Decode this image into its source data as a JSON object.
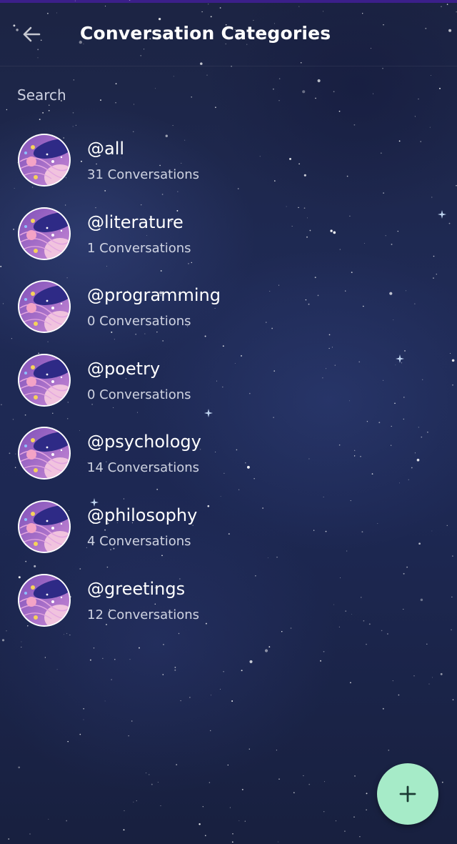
{
  "header": {
    "title": "Conversation Categories",
    "back_icon": "arrow-left-icon"
  },
  "search": {
    "placeholder": "Search",
    "value": ""
  },
  "categories": [
    {
      "name": "@all",
      "count": "31 Conversations"
    },
    {
      "name": "@literature",
      "count": "1 Conversations"
    },
    {
      "name": "@programming",
      "count": "0 Conversations"
    },
    {
      "name": "@poetry",
      "count": "0 Conversations"
    },
    {
      "name": "@psychology",
      "count": "14 Conversations"
    },
    {
      "name": "@philosophy",
      "count": "4 Conversations"
    },
    {
      "name": "@greetings",
      "count": "12 Conversations"
    }
  ],
  "fab": {
    "icon": "plus-icon"
  },
  "colors": {
    "background": "#1f2a55",
    "top_strip": "#3b1f8a",
    "fab": "#a6ebc8",
    "fab_icon": "#1b3a33",
    "avatar_ring": "#ffffff",
    "avatar_planet": "#b979d6"
  }
}
